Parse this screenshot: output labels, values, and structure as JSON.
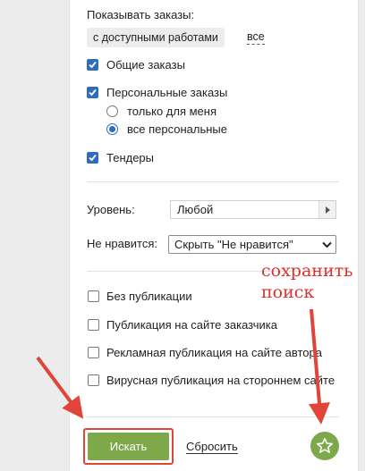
{
  "filters": {
    "show_orders_label": "Показывать заказы:",
    "work_filter_chip": "с доступными работами",
    "all_link": "все",
    "general_orders": {
      "label": "Общие заказы",
      "checked": true
    },
    "personal_orders": {
      "label": "Персональные заказы",
      "checked": true
    },
    "personal_options": [
      {
        "label": "только для меня",
        "selected": false
      },
      {
        "label": "все персональные",
        "selected": true
      }
    ],
    "tenders": {
      "label": "Тендеры",
      "checked": true
    }
  },
  "level": {
    "label": "Уровень:",
    "value": "Любой"
  },
  "dislike": {
    "label": "Не нравится:",
    "value": "Скрыть \"Не нравится\""
  },
  "publication_checks": [
    {
      "label": "Без публикации",
      "checked": false
    },
    {
      "label": "Публикация на сайте заказчика",
      "checked": false
    },
    {
      "label": "Рекламная публикация на сайте автора",
      "checked": false
    },
    {
      "label": "Вирусная публикация на стороннем сайте",
      "checked": false
    }
  ],
  "actions": {
    "search_label": "Искать",
    "reset_label": "Сбросить",
    "save_icon": "star-icon"
  },
  "annotation": {
    "line1": "сохранить",
    "line2": "поиск"
  },
  "colors": {
    "accent_green": "#7ea94a",
    "checkbox_blue": "#2f6cc0",
    "annotation_red": "#d8332c"
  }
}
